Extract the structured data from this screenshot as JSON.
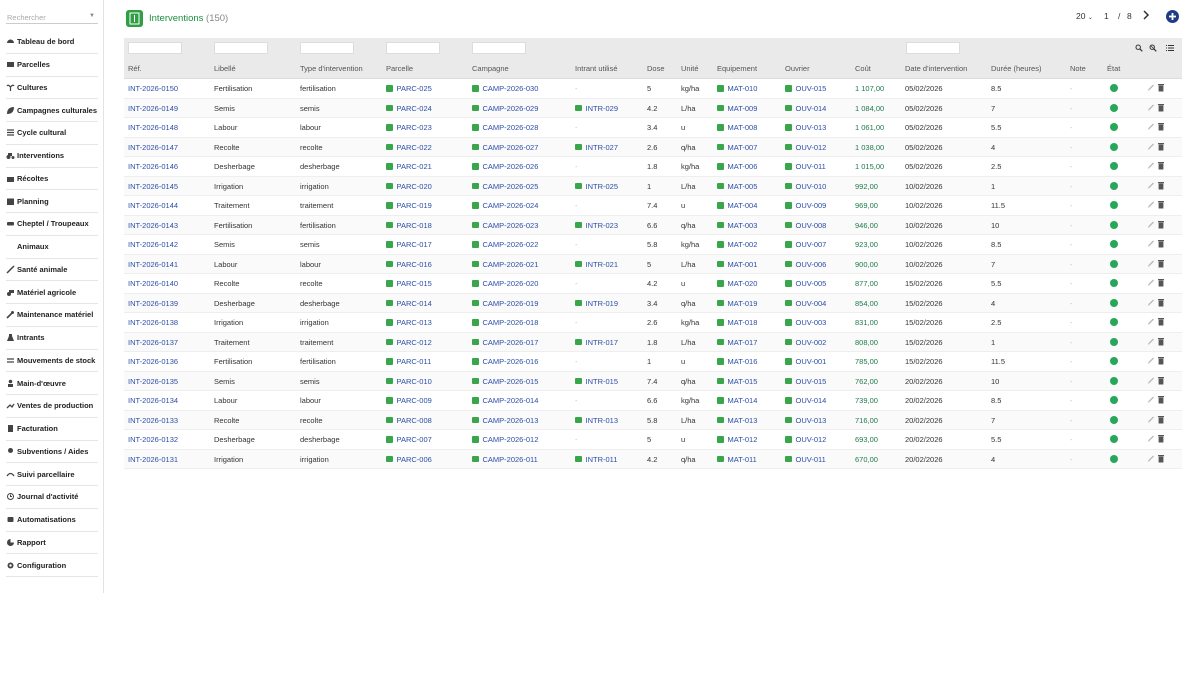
{
  "sidebar": {
    "search_placeholder": "Rechercher",
    "items": [
      {
        "label": "Tableau de bord",
        "icon": "dashboard-icon"
      },
      {
        "label": "Parcelles",
        "icon": "map-icon"
      },
      {
        "label": "Cultures",
        "icon": "plant-icon"
      },
      {
        "label": "Campagnes culturales",
        "icon": "leaf-icon"
      },
      {
        "label": "Cycle cultural",
        "icon": "list-icon"
      },
      {
        "label": "Interventions",
        "icon": "tractor-icon"
      },
      {
        "label": "Récoltes",
        "icon": "basket-icon"
      },
      {
        "label": "Planning",
        "icon": "calendar-icon"
      },
      {
        "label": "Cheptel / Troupeaux",
        "icon": "cow-icon"
      },
      {
        "label": "Animaux",
        "icon": ""
      },
      {
        "label": "Santé animale",
        "icon": "syringe-icon"
      },
      {
        "label": "Matériel agricole",
        "icon": "machine-icon"
      },
      {
        "label": "Maintenance matériel",
        "icon": "wrench-icon"
      },
      {
        "label": "Intrants",
        "icon": "flask-icon"
      },
      {
        "label": "Mouvements de stock",
        "icon": "transfer-icon"
      },
      {
        "label": "Main-d'œuvre",
        "icon": "worker-icon"
      },
      {
        "label": "Ventes de production",
        "icon": "sales-icon"
      },
      {
        "label": "Facturation",
        "icon": "invoice-icon"
      },
      {
        "label": "Subventions / Aides",
        "icon": "grant-icon"
      },
      {
        "label": "Suivi parcellaire",
        "icon": "tracking-icon"
      },
      {
        "label": "Journal d'activité",
        "icon": "history-icon"
      },
      {
        "label": "Automatisations",
        "icon": "robot-icon"
      },
      {
        "label": "Rapport",
        "icon": "report-icon"
      },
      {
        "label": "Configuration",
        "icon": "gear-icon"
      }
    ]
  },
  "header": {
    "title": "Interventions",
    "count": "(150)",
    "page_size": "20",
    "page_current": "1",
    "page_sep": "/",
    "page_total": "8"
  },
  "columns": [
    "Réf.",
    "Libellé",
    "Type d'intervention",
    "Parcelle",
    "Campagne",
    "Intrant utilisé",
    "Dose",
    "Unité",
    "Equipement",
    "Ouvrier",
    "Coût",
    "Date d'intervention",
    "Durée (heures)",
    "Note",
    "État"
  ],
  "rows": [
    {
      "ref": "INT-2026-0150",
      "lib": "Fertilisation",
      "type": "fertilisation",
      "parc": "PARC-025",
      "camp": "CAMP-2026-030",
      "intr": "-",
      "dose": "5",
      "unit": "kg/ha",
      "eq": "MAT-010",
      "ouv": "OUV-015",
      "cost": "1 107,00",
      "date": "05/02/2026",
      "dur": "8.5",
      "note": "-"
    },
    {
      "ref": "INT-2026-0149",
      "lib": "Semis",
      "type": "semis",
      "parc": "PARC-024",
      "camp": "CAMP-2026-029",
      "intr": "INTR-029",
      "dose": "4.2",
      "unit": "L/ha",
      "eq": "MAT-009",
      "ouv": "OUV-014",
      "cost": "1 084,00",
      "date": "05/02/2026",
      "dur": "7",
      "note": "-"
    },
    {
      "ref": "INT-2026-0148",
      "lib": "Labour",
      "type": "labour",
      "parc": "PARC-023",
      "camp": "CAMP-2026-028",
      "intr": "-",
      "dose": "3.4",
      "unit": "u",
      "eq": "MAT-008",
      "ouv": "OUV-013",
      "cost": "1 061,00",
      "date": "05/02/2026",
      "dur": "5.5",
      "note": "-"
    },
    {
      "ref": "INT-2026-0147",
      "lib": "Recolte",
      "type": "recolte",
      "parc": "PARC-022",
      "camp": "CAMP-2026-027",
      "intr": "INTR-027",
      "dose": "2.6",
      "unit": "q/ha",
      "eq": "MAT-007",
      "ouv": "OUV-012",
      "cost": "1 038,00",
      "date": "05/02/2026",
      "dur": "4",
      "note": "-"
    },
    {
      "ref": "INT-2026-0146",
      "lib": "Desherbage",
      "type": "desherbage",
      "parc": "PARC-021",
      "camp": "CAMP-2026-026",
      "intr": "-",
      "dose": "1.8",
      "unit": "kg/ha",
      "eq": "MAT-006",
      "ouv": "OUV-011",
      "cost": "1 015,00",
      "date": "05/02/2026",
      "dur": "2.5",
      "note": "-"
    },
    {
      "ref": "INT-2026-0145",
      "lib": "Irrigation",
      "type": "irrigation",
      "parc": "PARC-020",
      "camp": "CAMP-2026-025",
      "intr": "INTR-025",
      "dose": "1",
      "unit": "L/ha",
      "eq": "MAT-005",
      "ouv": "OUV-010",
      "cost": "992,00",
      "date": "10/02/2026",
      "dur": "1",
      "note": "-"
    },
    {
      "ref": "INT-2026-0144",
      "lib": "Traitement",
      "type": "traitement",
      "parc": "PARC-019",
      "camp": "CAMP-2026-024",
      "intr": "-",
      "dose": "7.4",
      "unit": "u",
      "eq": "MAT-004",
      "ouv": "OUV-009",
      "cost": "969,00",
      "date": "10/02/2026",
      "dur": "11.5",
      "note": "-"
    },
    {
      "ref": "INT-2026-0143",
      "lib": "Fertilisation",
      "type": "fertilisation",
      "parc": "PARC-018",
      "camp": "CAMP-2026-023",
      "intr": "INTR-023",
      "dose": "6.6",
      "unit": "q/ha",
      "eq": "MAT-003",
      "ouv": "OUV-008",
      "cost": "946,00",
      "date": "10/02/2026",
      "dur": "10",
      "note": "-"
    },
    {
      "ref": "INT-2026-0142",
      "lib": "Semis",
      "type": "semis",
      "parc": "PARC-017",
      "camp": "CAMP-2026-022",
      "intr": "-",
      "dose": "5.8",
      "unit": "kg/ha",
      "eq": "MAT-002",
      "ouv": "OUV-007",
      "cost": "923,00",
      "date": "10/02/2026",
      "dur": "8.5",
      "note": "-"
    },
    {
      "ref": "INT-2026-0141",
      "lib": "Labour",
      "type": "labour",
      "parc": "PARC-016",
      "camp": "CAMP-2026-021",
      "intr": "INTR-021",
      "dose": "5",
      "unit": "L/ha",
      "eq": "MAT-001",
      "ouv": "OUV-006",
      "cost": "900,00",
      "date": "10/02/2026",
      "dur": "7",
      "note": "-"
    },
    {
      "ref": "INT-2026-0140",
      "lib": "Recolte",
      "type": "recolte",
      "parc": "PARC-015",
      "camp": "CAMP-2026-020",
      "intr": "-",
      "dose": "4.2",
      "unit": "u",
      "eq": "MAT-020",
      "ouv": "OUV-005",
      "cost": "877,00",
      "date": "15/02/2026",
      "dur": "5.5",
      "note": "-"
    },
    {
      "ref": "INT-2026-0139",
      "lib": "Desherbage",
      "type": "desherbage",
      "parc": "PARC-014",
      "camp": "CAMP-2026-019",
      "intr": "INTR-019",
      "dose": "3.4",
      "unit": "q/ha",
      "eq": "MAT-019",
      "ouv": "OUV-004",
      "cost": "854,00",
      "date": "15/02/2026",
      "dur": "4",
      "note": "-"
    },
    {
      "ref": "INT-2026-0138",
      "lib": "Irrigation",
      "type": "irrigation",
      "parc": "PARC-013",
      "camp": "CAMP-2026-018",
      "intr": "-",
      "dose": "2.6",
      "unit": "kg/ha",
      "eq": "MAT-018",
      "ouv": "OUV-003",
      "cost": "831,00",
      "date": "15/02/2026",
      "dur": "2.5",
      "note": "-"
    },
    {
      "ref": "INT-2026-0137",
      "lib": "Traitement",
      "type": "traitement",
      "parc": "PARC-012",
      "camp": "CAMP-2026-017",
      "intr": "INTR-017",
      "dose": "1.8",
      "unit": "L/ha",
      "eq": "MAT-017",
      "ouv": "OUV-002",
      "cost": "808,00",
      "date": "15/02/2026",
      "dur": "1",
      "note": "-"
    },
    {
      "ref": "INT-2026-0136",
      "lib": "Fertilisation",
      "type": "fertilisation",
      "parc": "PARC-011",
      "camp": "CAMP-2026-016",
      "intr": "-",
      "dose": "1",
      "unit": "u",
      "eq": "MAT-016",
      "ouv": "OUV-001",
      "cost": "785,00",
      "date": "15/02/2026",
      "dur": "11.5",
      "note": "-"
    },
    {
      "ref": "INT-2026-0135",
      "lib": "Semis",
      "type": "semis",
      "parc": "PARC-010",
      "camp": "CAMP-2026-015",
      "intr": "INTR-015",
      "dose": "7.4",
      "unit": "q/ha",
      "eq": "MAT-015",
      "ouv": "OUV-015",
      "cost": "762,00",
      "date": "20/02/2026",
      "dur": "10",
      "note": "-"
    },
    {
      "ref": "INT-2026-0134",
      "lib": "Labour",
      "type": "labour",
      "parc": "PARC-009",
      "camp": "CAMP-2026-014",
      "intr": "-",
      "dose": "6.6",
      "unit": "kg/ha",
      "eq": "MAT-014",
      "ouv": "OUV-014",
      "cost": "739,00",
      "date": "20/02/2026",
      "dur": "8.5",
      "note": "-"
    },
    {
      "ref": "INT-2026-0133",
      "lib": "Recolte",
      "type": "recolte",
      "parc": "PARC-008",
      "camp": "CAMP-2026-013",
      "intr": "INTR-013",
      "dose": "5.8",
      "unit": "L/ha",
      "eq": "MAT-013",
      "ouv": "OUV-013",
      "cost": "716,00",
      "date": "20/02/2026",
      "dur": "7",
      "note": "-"
    },
    {
      "ref": "INT-2026-0132",
      "lib": "Desherbage",
      "type": "desherbage",
      "parc": "PARC-007",
      "camp": "CAMP-2026-012",
      "intr": "-",
      "dose": "5",
      "unit": "u",
      "eq": "MAT-012",
      "ouv": "OUV-012",
      "cost": "693,00",
      "date": "20/02/2026",
      "dur": "5.5",
      "note": "-"
    },
    {
      "ref": "INT-2026-0131",
      "lib": "Irrigation",
      "type": "irrigation",
      "parc": "PARC-006",
      "camp": "CAMP-2026-011",
      "intr": "INTR-011",
      "dose": "4.2",
      "unit": "q/ha",
      "eq": "MAT-011",
      "ouv": "OUV-011",
      "cost": "670,00",
      "date": "20/02/2026",
      "dur": "4",
      "note": "-"
    }
  ],
  "colors": {
    "brand_green": "#2f9e44",
    "link_blue": "#2b4ea6",
    "state_green": "#28a75a",
    "add_button": "#1f3b82"
  }
}
